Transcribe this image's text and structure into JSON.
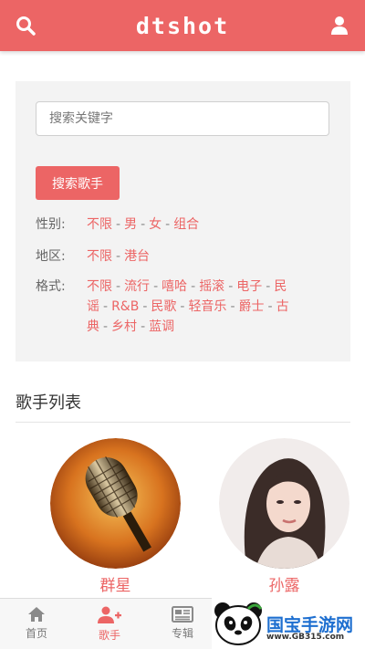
{
  "header": {
    "title": "dtshot"
  },
  "search": {
    "placeholder": "搜索关键字",
    "button_label": "搜索歌手"
  },
  "filters": {
    "gender": {
      "label": "性别:",
      "options": [
        "不限",
        "男",
        "女",
        "组合"
      ]
    },
    "region": {
      "label": "地区:",
      "options": [
        "不限",
        "港台"
      ]
    },
    "format": {
      "label": "格式:",
      "options": [
        "不限",
        "流行",
        "嘻哈",
        "摇滚",
        "电子",
        "民谣",
        "R&B",
        "民歌",
        "轻音乐",
        "爵士",
        "古典",
        "乡村",
        "蓝调"
      ]
    }
  },
  "section": {
    "title": "歌手列表"
  },
  "artists": [
    {
      "name": "群星",
      "image": "microphone-image"
    },
    {
      "name": "孙露",
      "image": "portrait-image"
    }
  ],
  "nav": [
    {
      "label": "首页",
      "icon": "home-icon",
      "active": false
    },
    {
      "label": "歌手",
      "icon": "add-user-icon",
      "active": true
    },
    {
      "label": "专辑",
      "icon": "newspaper-icon",
      "active": false
    }
  ],
  "watermark": {
    "text": "国宝手游网",
    "url": "www.GB315.com"
  },
  "colors": {
    "accent": "#ec6565",
    "panel": "#f3f3f3",
    "text": "#333333"
  }
}
